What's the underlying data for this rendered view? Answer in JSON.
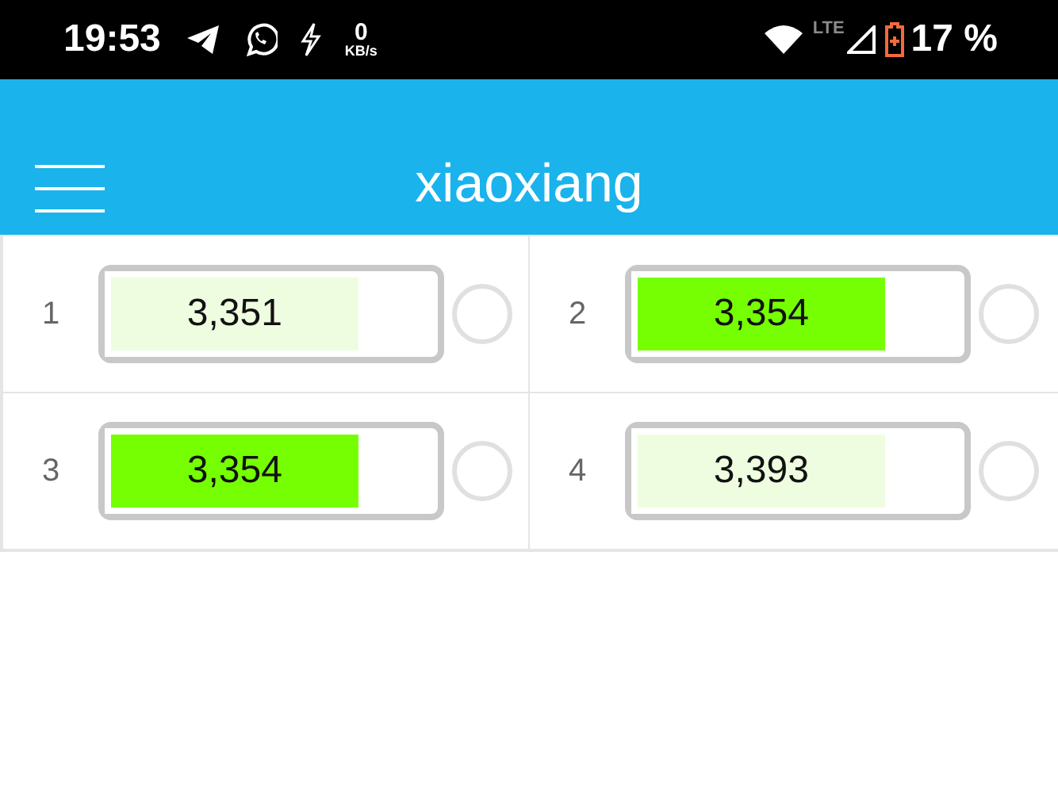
{
  "status_bar": {
    "time": "19:53",
    "speed_value": "0",
    "speed_unit": "KB/s",
    "network": "LTE",
    "battery": "17 %"
  },
  "header": {
    "title": "xiaoxiang"
  },
  "cells": [
    {
      "index": "1",
      "reading": "3,351",
      "level": 0.78,
      "color": "#eefde0",
      "selected": false
    },
    {
      "index": "2",
      "reading": "3,354",
      "level": 0.78,
      "color": "#76ff03",
      "selected": false
    },
    {
      "index": "3",
      "reading": "3,354",
      "level": 0.78,
      "color": "#76ff03",
      "selected": false
    },
    {
      "index": "4",
      "reading": "3,393",
      "level": 0.78,
      "color": "#eefde0",
      "selected": false
    }
  ]
}
